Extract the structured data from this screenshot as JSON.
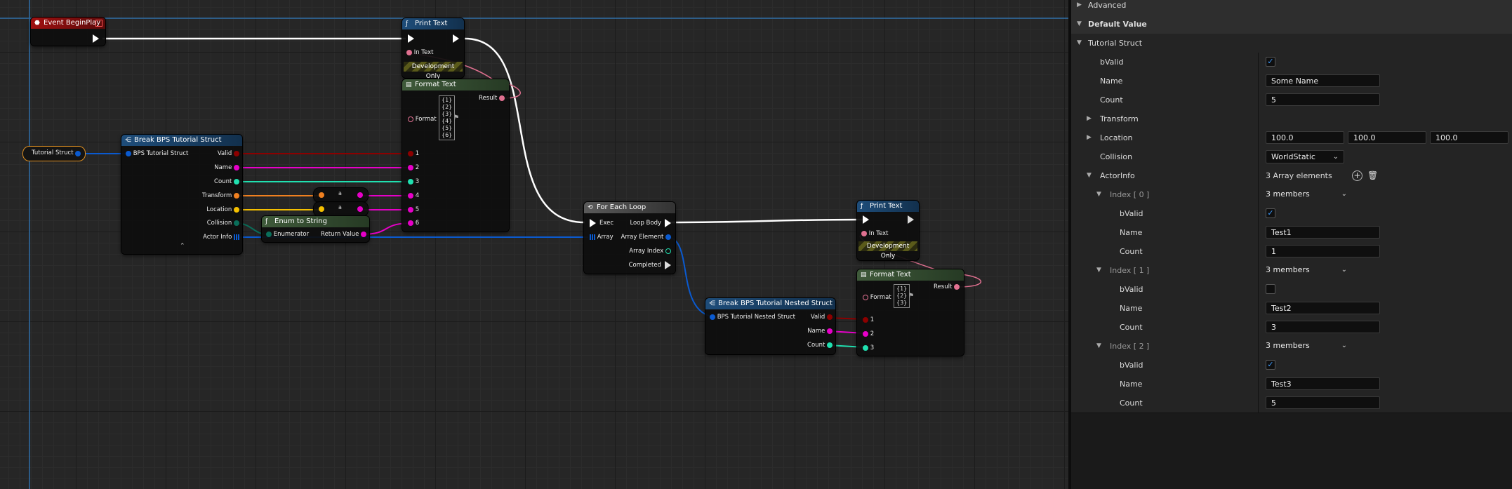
{
  "graph": {
    "event_begin_play": {
      "title": "Event BeginPlay"
    },
    "print_text_1": {
      "title": "Print Text",
      "in_text": "In Text",
      "dev_only": "Development Only"
    },
    "format_text_1": {
      "title": "Format Text",
      "format_label": "Format",
      "format_args": [
        "{1}",
        "{2}",
        "{3}",
        "{4}",
        "{5}",
        "{6}"
      ],
      "result": "Result",
      "pins": [
        "1",
        "2",
        "3",
        "4",
        "5",
        "6"
      ]
    },
    "tutorial_struct_var": {
      "label": "Tutorial Struct"
    },
    "break_struct": {
      "title": "Break BPS Tutorial Struct",
      "input": "BPS Tutorial Struct",
      "outputs": [
        "Valid",
        "Name",
        "Count",
        "Transform",
        "Location",
        "Collision",
        "Actor Info"
      ]
    },
    "convert_node": {
      "glyph": "a"
    },
    "enum_to_string": {
      "title": "Enum to String",
      "input": "Enumerator",
      "output": "Return Value"
    },
    "for_each_loop": {
      "title": "For Each Loop",
      "exec": "Exec",
      "array": "Array",
      "loop_body": "Loop Body",
      "array_element": "Array Element",
      "array_index": "Array Index",
      "completed": "Completed"
    },
    "print_text_2": {
      "title": "Print Text",
      "in_text": "In Text",
      "dev_only": "Development Only"
    },
    "format_text_2": {
      "title": "Format Text",
      "format_label": "Format",
      "format_args": [
        "{1}",
        "{2}",
        "{3}"
      ],
      "result": "Result",
      "pins": [
        "1",
        "2",
        "3"
      ]
    },
    "break_nested": {
      "title": "Break BPS Tutorial Nested Struct",
      "input": "BPS Tutorial Nested Struct",
      "outputs": [
        "Valid",
        "Name",
        "Count"
      ]
    }
  },
  "details": {
    "advanced": "Advanced",
    "default_value": "Default Value",
    "tutorial_struct": "Tutorial Struct",
    "bvalid": {
      "label": "bValid",
      "checked": true
    },
    "name": {
      "label": "Name",
      "value": "Some Name"
    },
    "count": {
      "label": "Count",
      "value": "5"
    },
    "transform": "Transform",
    "location": {
      "label": "Location",
      "x": "100.0",
      "y": "100.0",
      "z": "100.0"
    },
    "collision": {
      "label": "Collision",
      "value": "WorldStatic"
    },
    "actor_info": {
      "label": "ActorInfo",
      "summary": "3 Array elements"
    },
    "elements": [
      {
        "label": "Index [ 0 ]",
        "summary": "3 members",
        "bvalid_label": "bValid",
        "bvalid": true,
        "name_label": "Name",
        "name": "Test1",
        "count_label": "Count",
        "count": "1"
      },
      {
        "label": "Index [ 1 ]",
        "summary": "3 members",
        "bvalid_label": "bValid",
        "bvalid": false,
        "name_label": "Name",
        "name": "Test2",
        "count_label": "Count",
        "count": "3"
      },
      {
        "label": "Index [ 2 ]",
        "summary": "3 members",
        "bvalid_label": "bValid",
        "bvalid": true,
        "name_label": "Name",
        "name": "Test3",
        "count_label": "Count",
        "count": "5"
      }
    ]
  },
  "colors": {
    "exec": "#ffffff",
    "bool": "#8c0000",
    "string": "#e600c8",
    "int": "#20e0b0",
    "struct": "#0a5ad0",
    "text": "#e07090",
    "vector": "#f5c000",
    "transform": "#f08020",
    "enum": "#0a6e5a"
  }
}
